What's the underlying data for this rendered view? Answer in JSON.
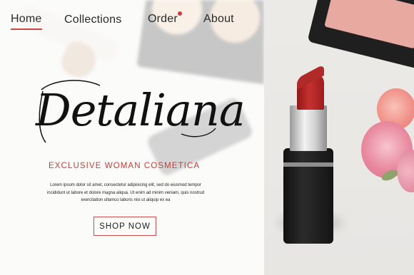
{
  "nav": {
    "items": [
      {
        "label": "Home",
        "active": true
      },
      {
        "label": "Collections",
        "active": false
      },
      {
        "label": "Order",
        "active": false,
        "badge_dot": true
      },
      {
        "label": "About",
        "active": false
      }
    ]
  },
  "hero": {
    "brand": "Detaliana",
    "tagline": "EXCLUSIVE WOMAN COSMETICA",
    "body": "Lorem ipsum dolor sit amet, consectetur adipisicing elit, sed do eiusmod tempor incididunt ut labore et dolore magna aliqua. Ut enim ad minim veniam, quis nostrud exercitation ullamco laboris nisi ut aliquip ex ea",
    "cta_label": "SHOP NOW"
  },
  "colors": {
    "accent": "#c94646",
    "text": "#2a2a2a"
  }
}
